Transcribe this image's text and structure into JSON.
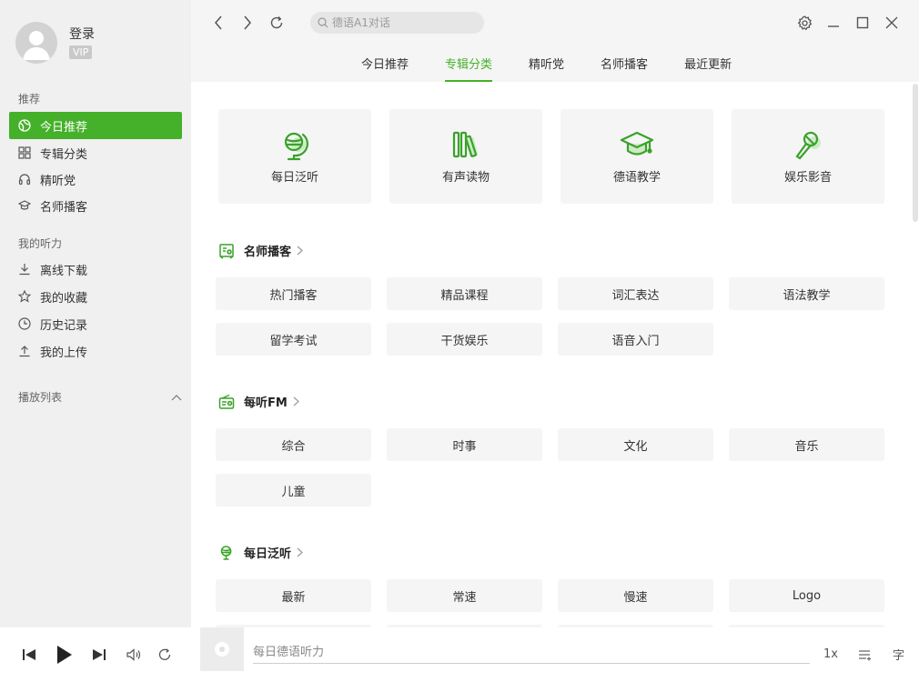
{
  "user": {
    "login_label": "登录",
    "vip_badge": "VIP"
  },
  "sidebar": {
    "recommend_title": "推荐",
    "recommend_items": [
      {
        "label": "今日推荐",
        "icon": "compass-icon",
        "active": true
      },
      {
        "label": "专辑分类",
        "icon": "grid-icon"
      },
      {
        "label": "精听党",
        "icon": "headphones-icon"
      },
      {
        "label": "名师播客",
        "icon": "graduation-cap-icon"
      }
    ],
    "my_title": "我的听力",
    "my_items": [
      {
        "label": "离线下载",
        "icon": "download-icon"
      },
      {
        "label": "我的收藏",
        "icon": "star-icon"
      },
      {
        "label": "历史记录",
        "icon": "clock-icon"
      },
      {
        "label": "我的上传",
        "icon": "upload-icon"
      }
    ],
    "playlist_title": "播放列表"
  },
  "search": {
    "placeholder": "德语A1对话"
  },
  "tabs": [
    {
      "label": "今日推荐"
    },
    {
      "label": "专辑分类",
      "active": true
    },
    {
      "label": "精听党"
    },
    {
      "label": "名师播客"
    },
    {
      "label": "最近更新"
    }
  ],
  "categories": [
    {
      "label": "每日泛听",
      "icon": "globe-icon"
    },
    {
      "label": "有声读物",
      "icon": "books-icon"
    },
    {
      "label": "德语教学",
      "icon": "graduation-cap-icon"
    },
    {
      "label": "娱乐影音",
      "icon": "microphone-icon"
    }
  ],
  "sections": [
    {
      "title": "名师播客",
      "icon": "podcast-icon",
      "chips": [
        "热门播客",
        "精品课程",
        "词汇表达",
        "语法教学",
        "留学考试",
        "干货娱乐",
        "语音入门"
      ]
    },
    {
      "title": "每听FM",
      "icon": "radio-icon",
      "chips": [
        "综合",
        "时事",
        "文化",
        "音乐",
        "儿童"
      ]
    },
    {
      "title": "每日泛听",
      "icon": "globe-icon",
      "chips": [
        "最新",
        "常速",
        "慢速",
        "Logo"
      ]
    }
  ],
  "player": {
    "track_title": "每日德语听力",
    "speed": "1x",
    "lyrics_label": "字"
  },
  "colors": {
    "accent": "#45b029",
    "sidebar_bg": "#f0f0f0",
    "chip_bg": "#f5f5f5"
  }
}
